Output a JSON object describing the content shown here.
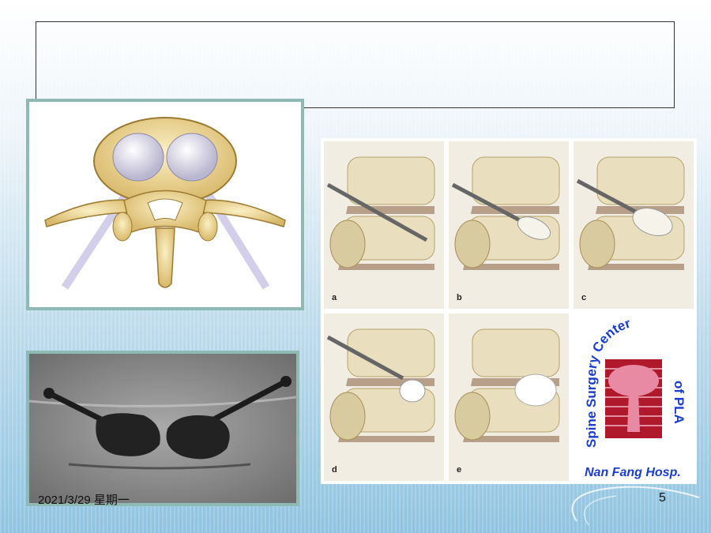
{
  "slide": {
    "title": "",
    "footer_date": "2021/3/29 星期一",
    "page_number": "5"
  },
  "figures": {
    "vertebra_diagram": {
      "icon": "vertebra-cross-section-illustration"
    },
    "xray": {
      "icon": "fluoroscopy-xray-image"
    },
    "procedure_steps": {
      "panels": [
        {
          "label": "a"
        },
        {
          "label": "b"
        },
        {
          "label": "c"
        },
        {
          "label": "d"
        },
        {
          "label": "e"
        }
      ]
    },
    "logo": {
      "line1": "Spine Surgery Center",
      "line2": "of PLA",
      "line3": "Nan Fang Hosp."
    }
  },
  "colors": {
    "frame_border": "#8fb9b3",
    "logo_blue": "#1a3ccf",
    "logo_red": "#b0182b",
    "logo_pink": "#e98aa4"
  }
}
